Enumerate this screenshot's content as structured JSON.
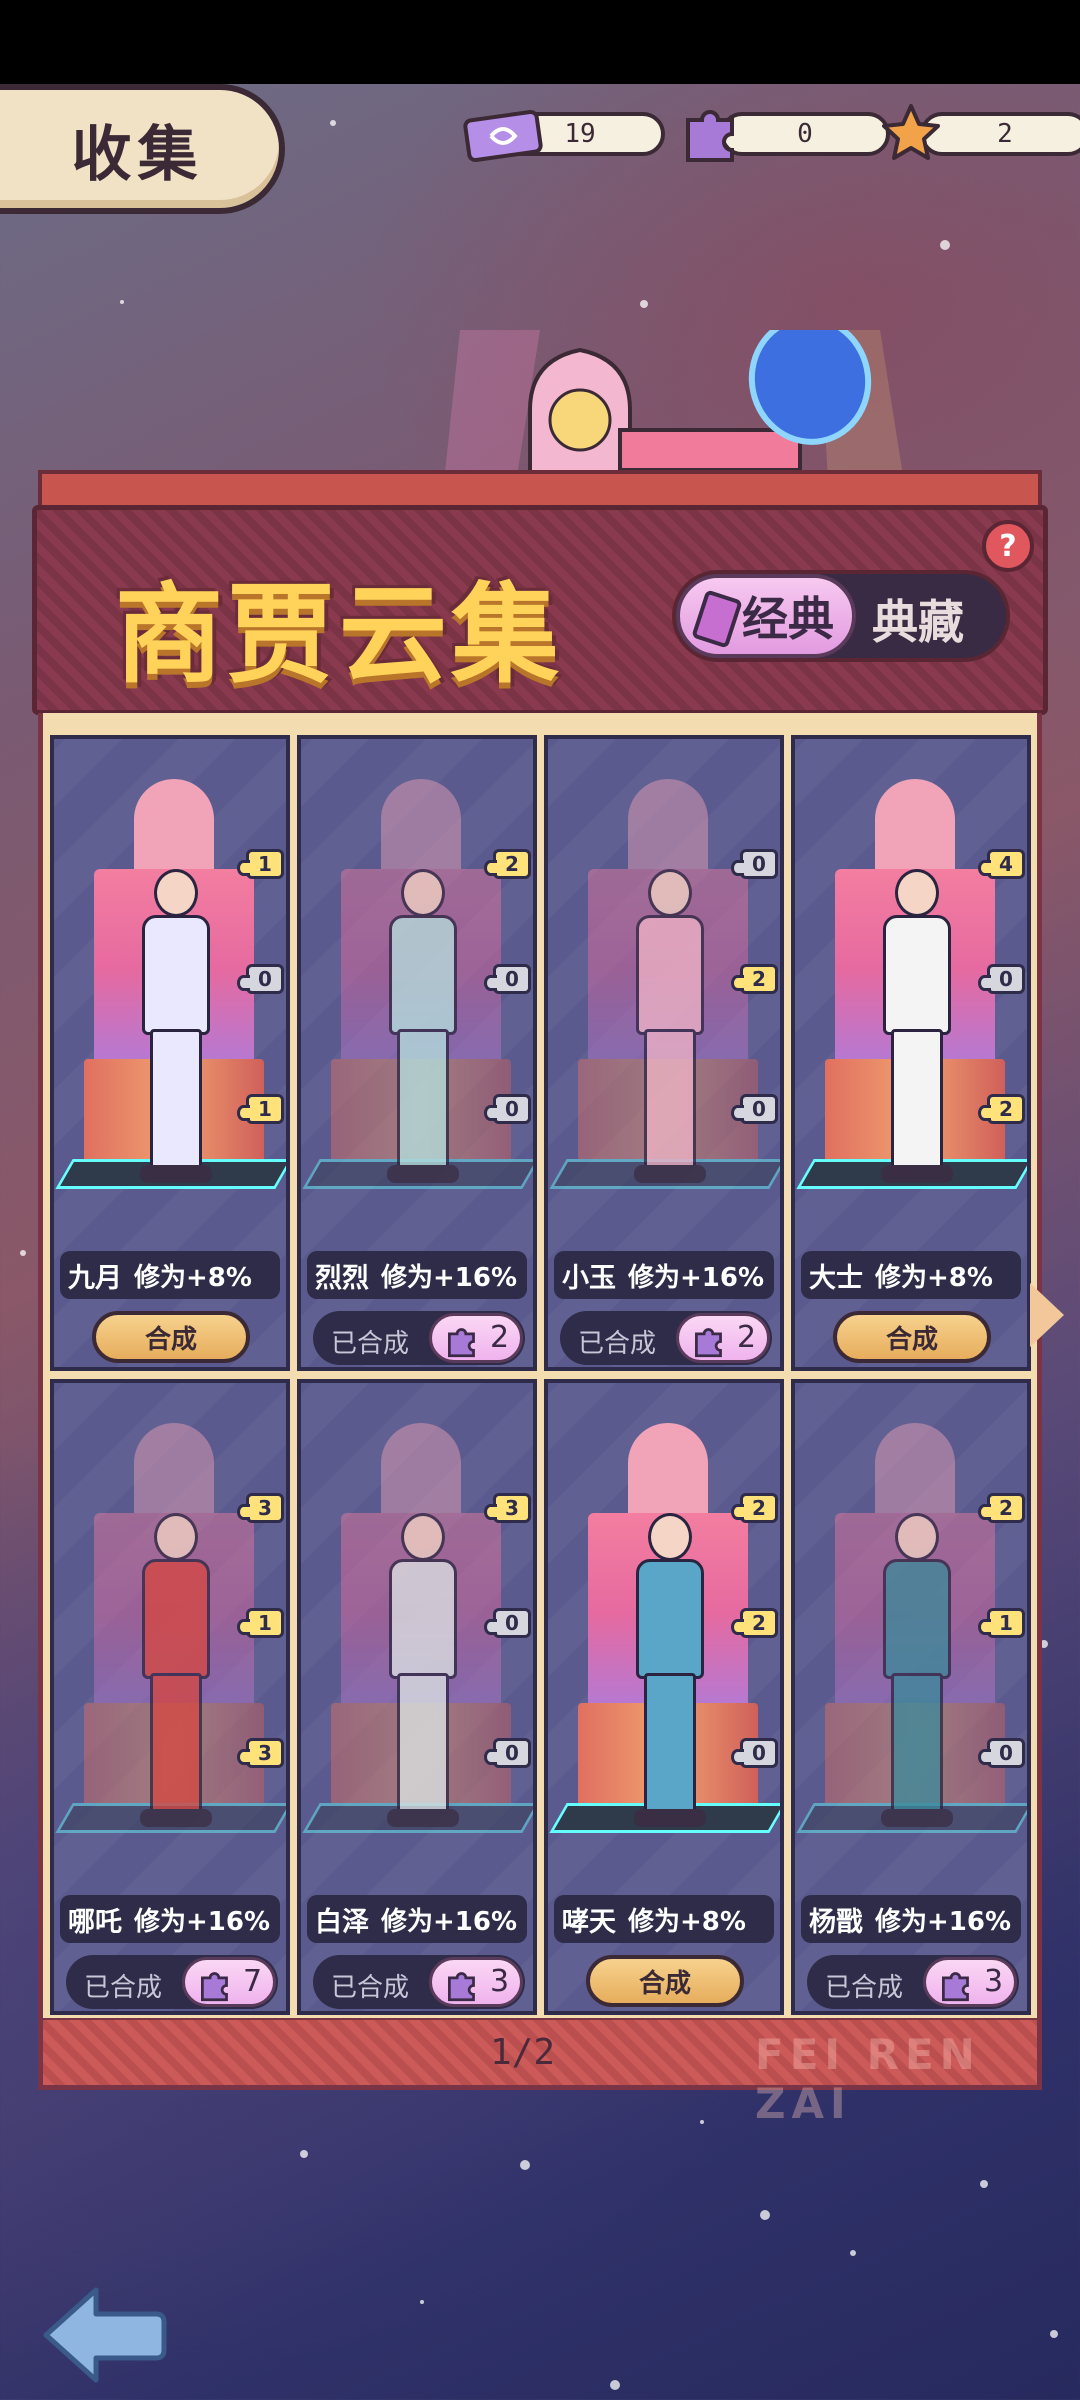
{
  "header": {
    "title": "收集"
  },
  "currencies": [
    {
      "icon": "ticket-icon",
      "value": "19",
      "color": "#b58ee8"
    },
    {
      "icon": "puzzle-piece-icon",
      "value": "0",
      "color": "#a77ad8"
    },
    {
      "icon": "star-icon",
      "value": "2",
      "color": "#f2a34a"
    }
  ],
  "banner": {
    "title": "商贾云集",
    "tab_active": "经典",
    "tab_inactive": "典藏",
    "help": "?"
  },
  "cards": [
    {
      "name": "九月",
      "bonus": "修为+8%",
      "badges": [
        "1",
        "0",
        "1"
      ],
      "action": "合成",
      "synthesized": false,
      "outfit": "#eae8ff"
    },
    {
      "name": "烈烈",
      "bonus": "修为+16%",
      "badges": [
        "2",
        "0",
        "0"
      ],
      "done_label": "已合成",
      "pieces": "2",
      "synthesized": true,
      "outfit": "#b7e3e0"
    },
    {
      "name": "小玉",
      "bonus": "修为+16%",
      "badges": [
        "0",
        "2",
        "0"
      ],
      "done_label": "已合成",
      "pieces": "2",
      "synthesized": true,
      "outfit": "#f3b6c8"
    },
    {
      "name": "大士",
      "bonus": "修为+8%",
      "badges": [
        "4",
        "0",
        "2"
      ],
      "action": "合成",
      "synthesized": false,
      "outfit": "#f4f4f4"
    },
    {
      "name": "哪吒",
      "bonus": "修为+16%",
      "badges": [
        "3",
        "1",
        "3"
      ],
      "done_label": "已合成",
      "pieces": "7",
      "synthesized": true,
      "outfit": "#d8463e"
    },
    {
      "name": "白泽",
      "bonus": "修为+16%",
      "badges": [
        "3",
        "0",
        "0"
      ],
      "done_label": "已合成",
      "pieces": "3",
      "synthesized": true,
      "outfit": "#dfe6e6"
    },
    {
      "name": "哮天",
      "bonus": "修为+8%",
      "badges": [
        "2",
        "2",
        "0"
      ],
      "action": "合成",
      "synthesized": false,
      "outfit": "#5aa6c8"
    },
    {
      "name": "杨戬",
      "bonus": "修为+16%",
      "badges": [
        "2",
        "1",
        "0"
      ],
      "done_label": "已合成",
      "pieces": "3",
      "synthesized": true,
      "outfit": "#3a8a9a"
    }
  ],
  "pagination": {
    "text": "1/2"
  },
  "watermark": "FEI REN ZAI"
}
